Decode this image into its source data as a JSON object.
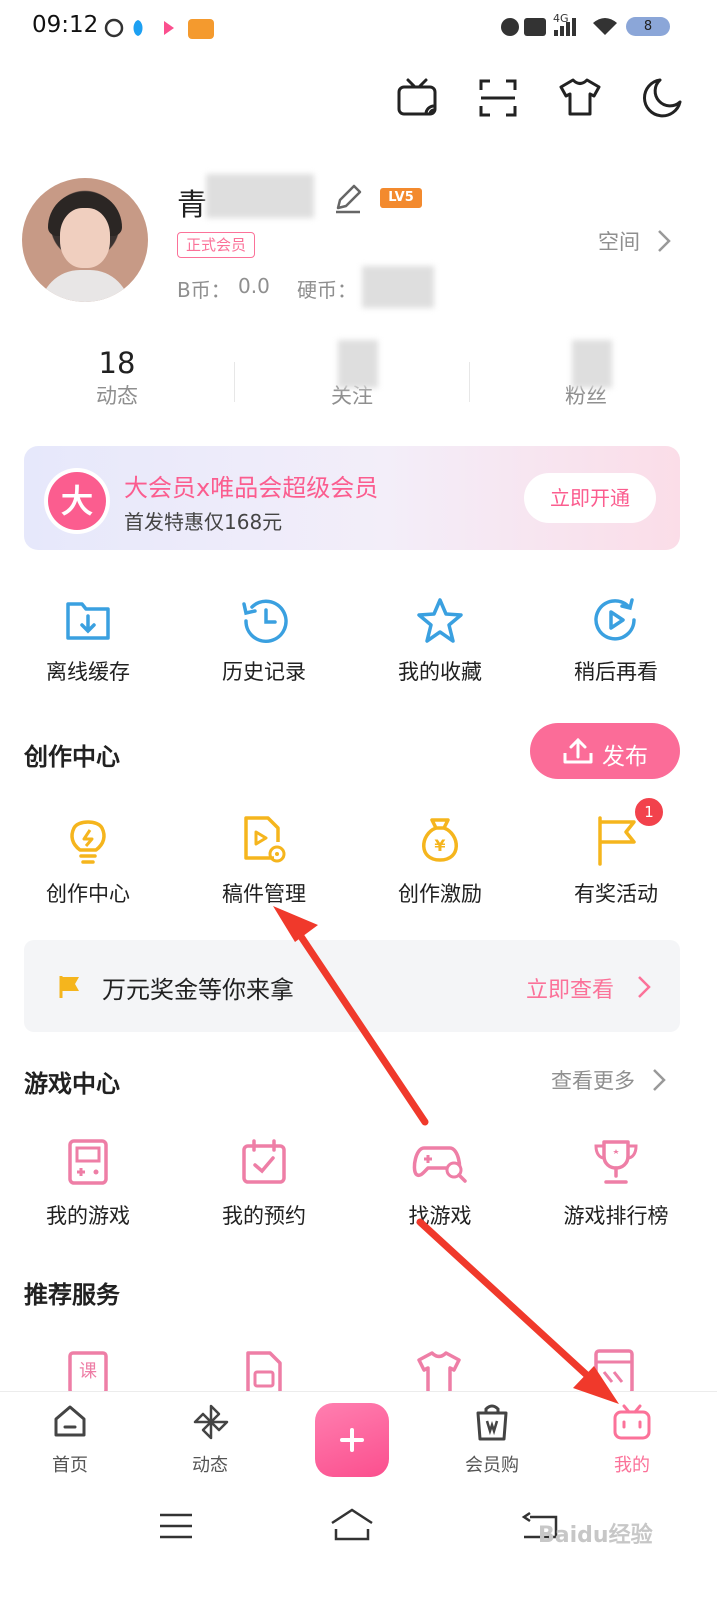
{
  "status_bar": {
    "time": "09:12",
    "battery": "8",
    "signal_label": "4G"
  },
  "profile": {
    "name_prefix": "青",
    "level": "LV5",
    "member_tag": "正式会员",
    "bcoin_label": "B币：",
    "bcoin_value": "0.0",
    "coin_label": "硬币：",
    "space_link": "空间"
  },
  "stats": [
    {
      "value": "18",
      "label": "动态"
    },
    {
      "value": "",
      "label": "关注"
    },
    {
      "value": "",
      "label": "粉丝"
    }
  ],
  "vip_banner": {
    "badge": "大",
    "title": "大会员x唯品会超级会员",
    "subtitle": "首发特惠仅168元",
    "button": "立即开通"
  },
  "quick_actions": [
    {
      "label": "离线缓存",
      "icon": "download-folder-icon"
    },
    {
      "label": "历史记录",
      "icon": "history-clock-icon"
    },
    {
      "label": "我的收藏",
      "icon": "star-icon"
    },
    {
      "label": "稍后再看",
      "icon": "watch-later-icon"
    }
  ],
  "creation": {
    "title": "创作中心",
    "publish_button": "发布",
    "items": [
      {
        "label": "创作中心",
        "icon": "lightbulb-icon"
      },
      {
        "label": "稿件管理",
        "icon": "manuscript-icon"
      },
      {
        "label": "创作激励",
        "icon": "money-bag-icon"
      },
      {
        "label": "有奖活动",
        "icon": "flag-icon",
        "badge": "1"
      }
    ]
  },
  "notice": {
    "text": "万元奖金等你来拿",
    "link": "立即查看"
  },
  "game_center": {
    "title": "游戏中心",
    "more": "查看更多",
    "items": [
      {
        "label": "我的游戏",
        "icon": "gameboy-icon"
      },
      {
        "label": "我的预约",
        "icon": "calendar-check-icon"
      },
      {
        "label": "找游戏",
        "icon": "gamepad-search-icon"
      },
      {
        "label": "游戏排行榜",
        "icon": "trophy-icon"
      }
    ]
  },
  "recommended": {
    "title": "推荐服务",
    "icons": [
      "course-icon",
      "sim-card-icon",
      "tshirt-icon",
      "comic-icon"
    ]
  },
  "tabbar": [
    {
      "label": "首页",
      "icon": "home-icon"
    },
    {
      "label": "动态",
      "icon": "pinwheel-icon"
    },
    {
      "label": "",
      "icon": "plus-icon"
    },
    {
      "label": "会员购",
      "icon": "shopping-bag-icon"
    },
    {
      "label": "我的",
      "icon": "tv-mascot-icon",
      "active": true
    }
  ],
  "watermark": "Baidu经验",
  "colors": {
    "brand_pink": "#fb7299",
    "gold": "#f5b51d",
    "blue": "#3aa0e0",
    "game_pink": "#ee7ea6",
    "arrow_red": "#f0392b"
  }
}
